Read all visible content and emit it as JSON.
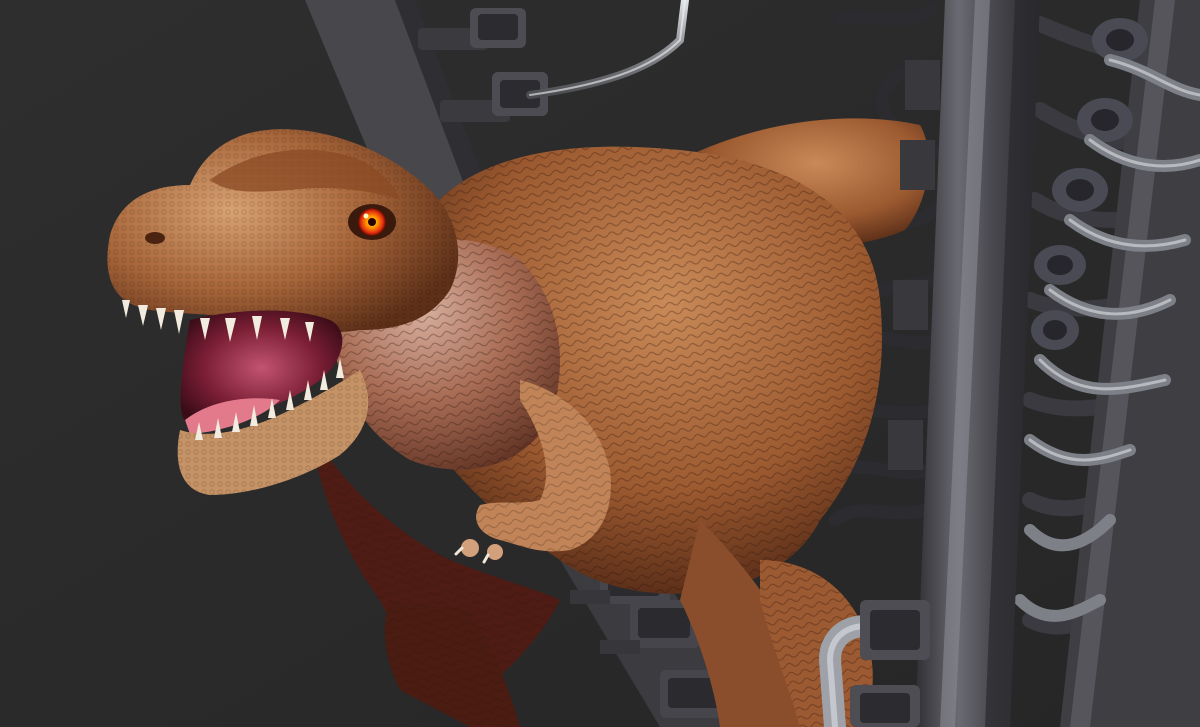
{
  "scene": {
    "subject": "t-rex-3d-render",
    "colors": {
      "background": "#2b2b2b",
      "skin_base": "#a8663a",
      "skin_light": "#d89a6a",
      "skin_dark": "#6b3a1e",
      "underside": "#5a2318",
      "mouth_inner": "#8a2a3a",
      "tongue": "#d86b7a",
      "teeth": "#f2ece0",
      "eye_iris": "#ff6a10",
      "eye_glow": "#ffd400",
      "metal_frame": "#4a4a4e",
      "metal_light": "#7d7d84",
      "metal_dark": "#2f2f33",
      "chrome_tube": "#a9abb0"
    }
  }
}
